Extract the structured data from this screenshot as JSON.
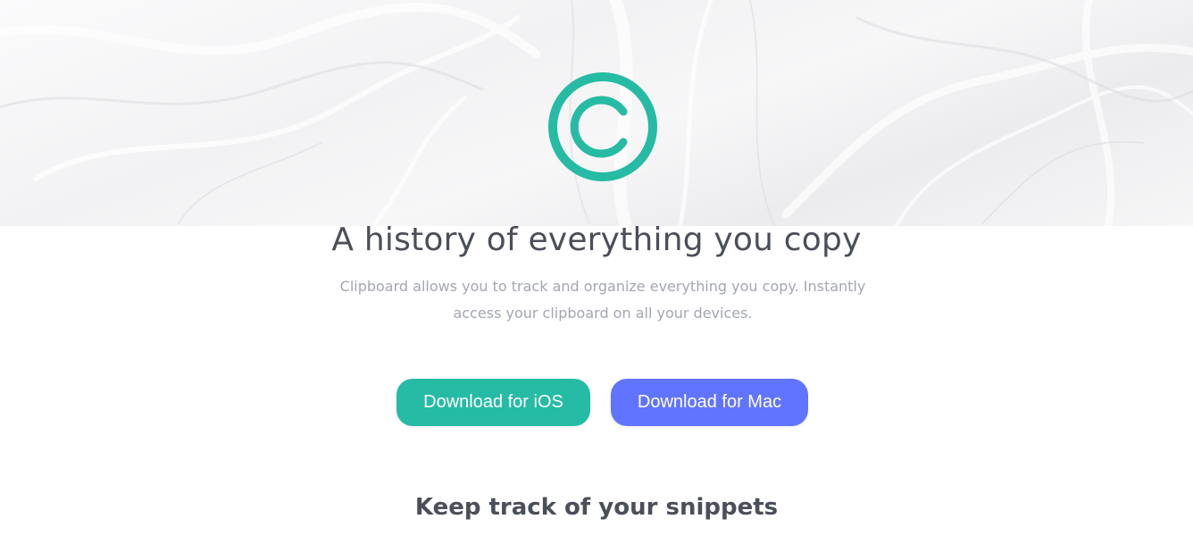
{
  "colors": {
    "accent_teal": "#26bba4",
    "accent_blue": "#6174ff",
    "heading": "#4b4f59",
    "muted_text": "#a3a7b1"
  },
  "hero": {
    "logo_icon": "copyright-logo-icon",
    "headline": "A history of everything you copy",
    "subtitle": "Clipboard allows you to track and organize everything you copy. Instantly access your clipboard on all your devices."
  },
  "actions": {
    "download_ios_label": "Download for iOS",
    "download_mac_label": "Download for Mac"
  },
  "snippets": {
    "title": "Keep track of your snippets"
  }
}
